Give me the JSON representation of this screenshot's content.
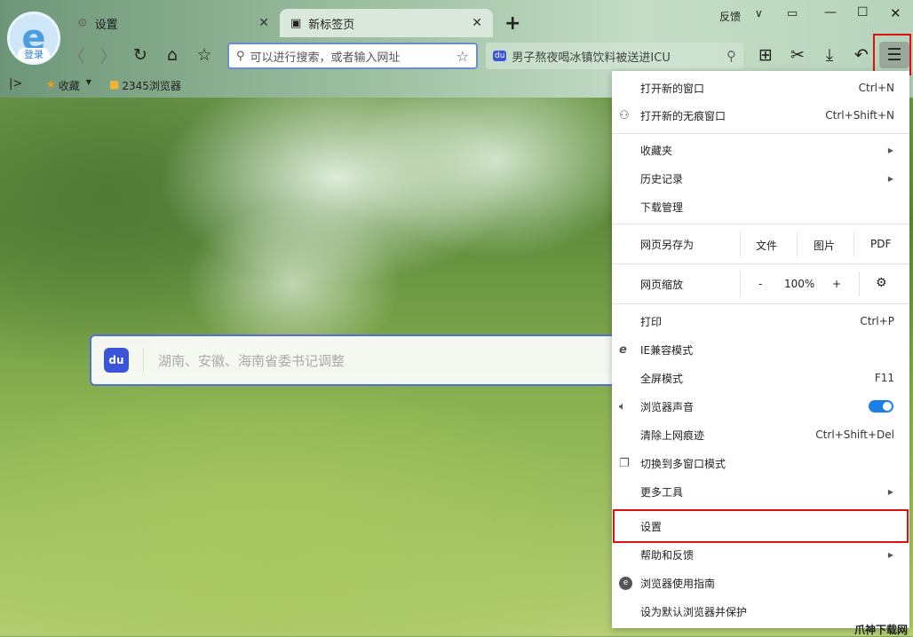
{
  "tabs": [
    {
      "label": "设置",
      "icon": "gear-icon"
    },
    {
      "label": "新标签页",
      "icon": "newtab-icon"
    }
  ],
  "login": "登录",
  "window": {
    "feedback": "反馈"
  },
  "address": {
    "placeholder": "可以进行搜索，或者输入网址"
  },
  "hot_search": "男子熬夜喝冰镇饮料被送进ICU",
  "bookmarks": [
    {
      "label": "收藏"
    },
    {
      "label": "2345浏览器"
    }
  ],
  "page_search": {
    "placeholder": "湖南、安徽、海南省委书记调整"
  },
  "menu": {
    "new_window": {
      "label": "打开新的窗口",
      "shortcut": "Ctrl+N"
    },
    "incognito": {
      "label": "打开新的无痕窗口",
      "shortcut": "Ctrl+Shift+N"
    },
    "favorites": "收藏夹",
    "history": "历史记录",
    "downloads": "下载管理",
    "save_as": {
      "label": "网页另存为",
      "file": "文件",
      "image": "图片",
      "pdf": "PDF"
    },
    "zoom": {
      "label": "网页缩放",
      "minus": "-",
      "value": "100%",
      "plus": "+"
    },
    "print": {
      "label": "打印",
      "shortcut": "Ctrl+P"
    },
    "ie_mode": "IE兼容模式",
    "fullscreen": {
      "label": "全屏模式",
      "shortcut": "F11"
    },
    "sound": {
      "label": "浏览器声音",
      "on": true
    },
    "clear": {
      "label": "清除上网痕迹",
      "shortcut": "Ctrl+Shift+Del"
    },
    "multiwindow": "切换到多窗口模式",
    "more_tools": "更多工具",
    "settings": "设置",
    "help": "帮助和反馈",
    "guide": "浏览器使用指南",
    "default": "设为默认浏览器并保护"
  },
  "watermark": "爪神下载网"
}
